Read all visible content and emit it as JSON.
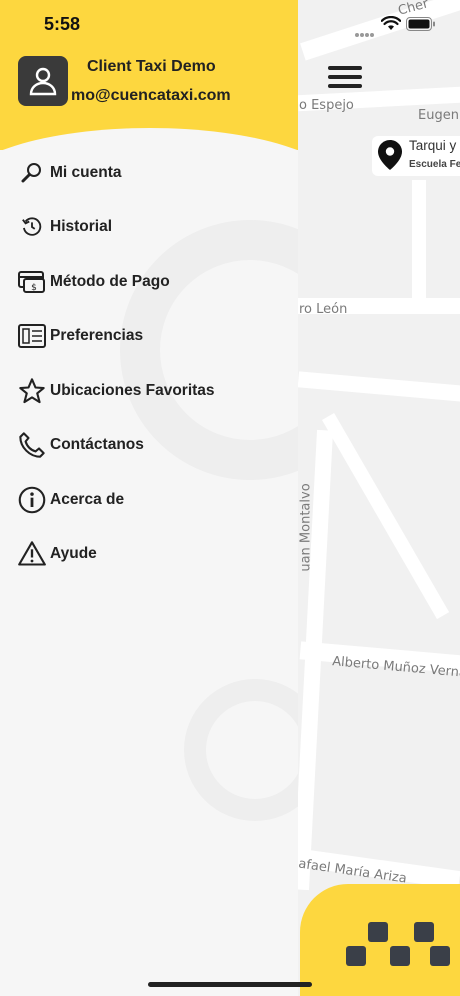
{
  "status_bar": {
    "time": "5:58"
  },
  "drawer": {
    "client_name": "Client Taxi Demo",
    "client_email": "mo@cuencataxi.com",
    "menu_items": [
      {
        "label": "Mi cuenta",
        "icon": "search-icon"
      },
      {
        "label": "Historial",
        "icon": "history-icon"
      },
      {
        "label": "Método de Pago",
        "icon": "payment-icon"
      },
      {
        "label": "Preferencias",
        "icon": "preferences-icon"
      },
      {
        "label": "Ubicaciones Favoritas",
        "icon": "star-icon"
      },
      {
        "label": "Contáctanos",
        "icon": "phone-icon"
      },
      {
        "label": "Acerca de",
        "icon": "info-icon"
      },
      {
        "label": "Ayude",
        "icon": "warning-icon"
      }
    ]
  },
  "map": {
    "streets": [
      "o Espejo",
      "Eugeni",
      "ro León",
      "uan Montalvo",
      "Alberto Muñoz Verna",
      "afael María Ariza",
      "Cher"
    ],
    "pin": {
      "title": "Tarqui y",
      "subtitle": "Escuela Fe"
    }
  },
  "colors": {
    "accent": "#fdd73f",
    "dark": "#3a3a3a",
    "background": "#f6f6f6"
  }
}
